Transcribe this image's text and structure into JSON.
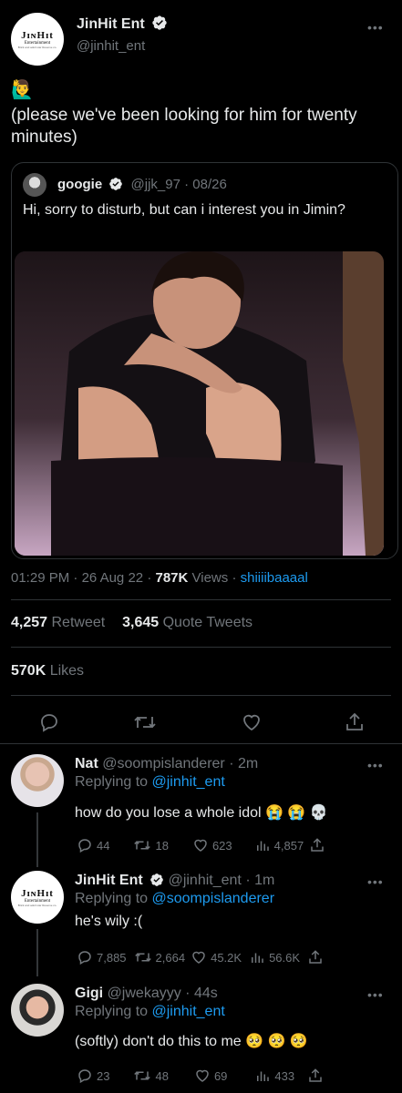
{
  "main_tweet": {
    "author_name": "JinHit Ent",
    "handle": "@jinhit_ent",
    "avatar_brand": "JɪɴHɪt",
    "avatar_sub": "Entertainment",
    "avatar_tiny": "Brick and adult star Reserve co.",
    "emoji": "🙋‍♂️",
    "text": "(please we've been looking for him for twenty minutes)",
    "quoted": {
      "author_name": "googie",
      "handle": "@jjk_97",
      "date": "08/26",
      "text": "Hi, sorry to disturb, but can i interest you in Jimin?"
    },
    "time": "01:29 PM",
    "date": "26 Aug 22",
    "views_count": "787K",
    "views_label": "Views",
    "via": "shiiiibaaaal",
    "retweets_count": "4,257",
    "retweets_label": "Retweet",
    "quotes_count": "3,645",
    "quotes_label": "Quote Tweets",
    "likes_count": "570K",
    "likes_label": "Likes"
  },
  "replies": [
    {
      "author_name": "Nat",
      "handle": "@soompislanderer",
      "time": "2m",
      "replying_label": "Replying to",
      "replying_to": "@jinhit_ent",
      "text": "how do you lose a whole idol 😭 😭 💀",
      "replies": "44",
      "retweets": "18",
      "likes": "623",
      "views": "4,857"
    },
    {
      "author_name": "JinHit Ent",
      "handle": "@jinhit_ent",
      "time": "1m",
      "replying_label": "Replying to",
      "replying_to": "@soompislanderer",
      "text": "he's wily :(",
      "replies": "7,885",
      "retweets": "2,664",
      "likes": "45.2K",
      "views": "56.6K"
    },
    {
      "author_name": "Gigi",
      "handle": "@jwekayyy",
      "time": "44s",
      "replying_label": "Replying to",
      "replying_to": "@jinhit_ent",
      "text": "(softly) don't do this to me 🥺 🥺 🥺",
      "replies": "23",
      "retweets": "48",
      "likes": "69",
      "views": "433"
    }
  ],
  "separator": "·",
  "more_glyph": "•••"
}
